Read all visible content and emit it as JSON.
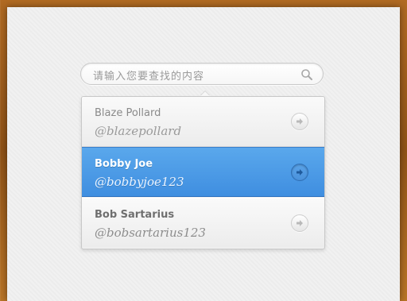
{
  "search": {
    "placeholder": "请输入您要查找的内容",
    "icon": "search-icon"
  },
  "results": [
    {
      "name": "Blaze Pollard",
      "handle": "@blazepollard",
      "selected": false,
      "icon": "arrow-right-circle-icon"
    },
    {
      "name": "Bobby Joe",
      "handle": "@bobbyjoe123",
      "selected": true,
      "icon": "arrow-right-circle-icon"
    },
    {
      "name": "Bob Sartarius",
      "handle": "@bobsartarius123",
      "selected": false,
      "icon": "arrow-right-circle-icon"
    }
  ],
  "colors": {
    "selected_row": "#4a9ae6",
    "background_frame": "#9a5a1e",
    "panel": "#f1f1f1"
  }
}
